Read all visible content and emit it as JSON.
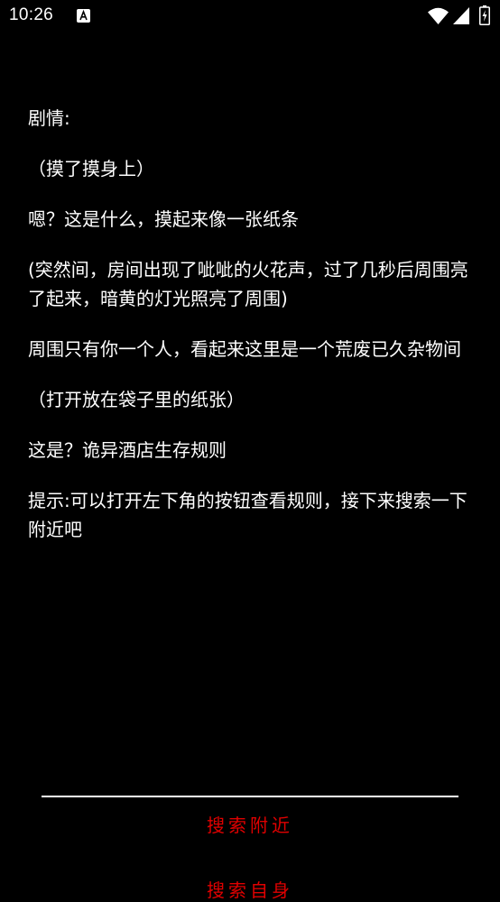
{
  "status_bar": {
    "time": "10:26",
    "notification_icon": "text-a-icon",
    "wifi_icon": "wifi-icon",
    "signal_icon": "signal-icon",
    "battery_icon": "battery-charging-icon"
  },
  "story": {
    "heading": "剧情:",
    "paragraphs": [
      "（摸了摸身上）",
      "嗯？这是什么，摸起来像一张纸条",
      "(突然间，房间出现了呲呲的火花声，过了几秒后周围亮了起来，暗黄的灯光照亮了周围)",
      "周围只有你一个人，看起来这里是一个荒废已久杂物间",
      "（打开放在袋子里的纸张）",
      "这是？诡异酒店生存规则",
      "提示:可以打开左下角的按钮查看规则，接下来搜索一下附近吧"
    ]
  },
  "actions": [
    {
      "label": "搜索附近"
    },
    {
      "label": "搜索自身"
    }
  ],
  "colors": {
    "background": "#000000",
    "text": "#ffffff",
    "action": "#e00000"
  }
}
